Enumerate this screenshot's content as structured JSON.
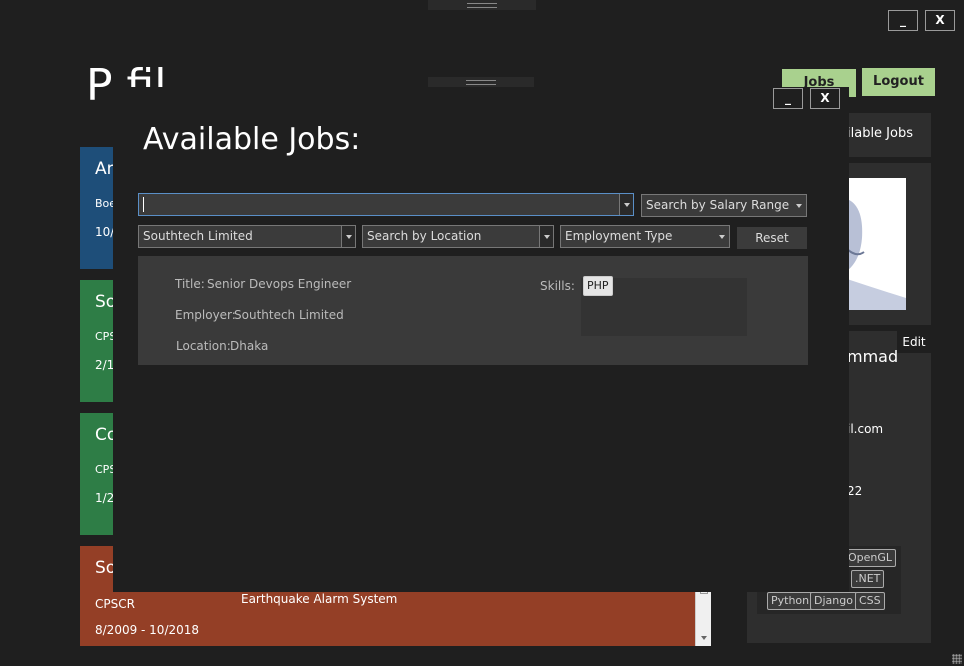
{
  "main_window": {
    "minimize_label": "_",
    "close_label": "X",
    "page_title": "P   fil",
    "logout_label": "Logout",
    "jobs_button_partial": "Jobs",
    "available_jobs_tab": "ilable Jobs",
    "edit_label": "Edit",
    "name_partial": "mmad",
    "email_partial": "il.com",
    "phone_partial": "22",
    "skills": [
      "OpenGL",
      ".NET",
      "Python",
      "Django",
      "CSS"
    ],
    "cards": [
      {
        "head": "An",
        "line1": "Boe",
        "line2": "10/",
        "color": "#1e4e79"
      },
      {
        "head": "So",
        "line1": "CPSC",
        "line2": "2/1",
        "color": "#2e7d46"
      },
      {
        "head": "Co",
        "line1": "CPS",
        "line2": "1/2",
        "color": "#2e7d46"
      },
      {
        "head": "So",
        "line1": "CPSCR",
        "line2": "8/2009 - 10/2018",
        "extra": "Earthquake Alarm System",
        "color": "#943f26"
      }
    ]
  },
  "dialog": {
    "minimize_label": "_",
    "close_label": "X",
    "title": "Available Jobs:",
    "search_value": "",
    "salary_range": "Search by Salary Range",
    "employer_filter": "Southtech Limited",
    "location_filter": "Search by Location",
    "employment_type": "Employment Type",
    "reset_label": "Reset",
    "jobs": [
      {
        "title_label": "Title:",
        "title": "Senior Devops Engineer",
        "employer_label": "Employer:",
        "employer": "Southtech Limited",
        "location_label": "Location:",
        "location": "Dhaka",
        "skills_label": "Skills:",
        "skills": [
          "PHP"
        ]
      }
    ]
  }
}
